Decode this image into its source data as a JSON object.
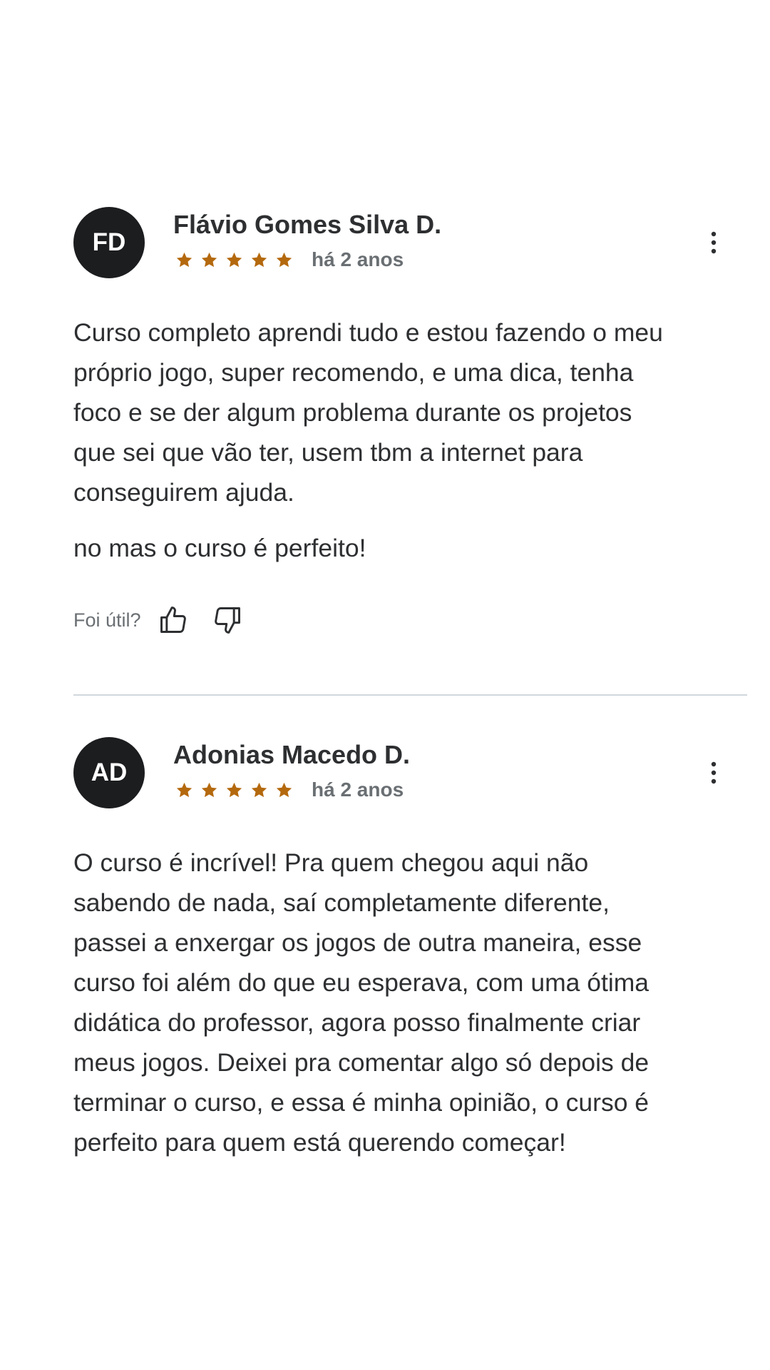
{
  "reviews": [
    {
      "initials": "FD",
      "name": "Flávio Gomes Silva D.",
      "rating": 5,
      "time": "há 2 anos",
      "paragraphs": [
        [
          "Curso completo aprendi tudo e estou fazendo o meu",
          "próprio jogo, super recomendo, e uma dica, tenha",
          "foco e se der algum problema durante os projetos",
          "que sei que vão ter, usem tbm a internet para",
          "conseguirem ajuda."
        ],
        [
          "no mas o curso é perfeito!"
        ]
      ],
      "helpful_label": "Foi útil?"
    },
    {
      "initials": "AD",
      "name": "Adonias Macedo D.",
      "rating": 5,
      "time": "há 2 anos",
      "paragraphs": [
        [
          "O curso é incrível! Pra quem chegou aqui não",
          "sabendo de nada, saí completamente diferente,",
          "passei a enxergar os jogos de outra maneira, esse",
          "curso foi além do que eu esperava, com uma ótima",
          "didática do professor, agora posso finalmente criar",
          "meus jogos. Deixei pra comentar algo só depois de",
          "terminar o curso, e essa é minha opinião, o curso é",
          "perfeito para quem está querendo começar!"
        ]
      ]
    }
  ],
  "icons": {
    "star": "star-icon",
    "more": "more-vertical-icon",
    "thumbs_up": "thumbs-up-icon",
    "thumbs_down": "thumbs-down-icon"
  },
  "colors": {
    "avatar_bg": "#1c1d1f",
    "star": "#b4690e",
    "text": "#2d2f31",
    "muted": "#6a6f73",
    "divider": "#d1d7dc"
  }
}
